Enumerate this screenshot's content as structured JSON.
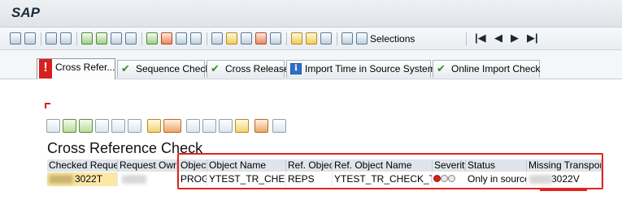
{
  "window": {
    "title": "SAP"
  },
  "toolbar": {
    "selections_label": "Selections"
  },
  "tabs": [
    {
      "label": "Cross Refer...",
      "icon": "error-icon"
    },
    {
      "label": "Sequence Check",
      "icon": "check-icon"
    },
    {
      "label": "Cross Release",
      "icon": "check-icon"
    },
    {
      "label": "Import Time in Source System",
      "icon": "info-icon"
    },
    {
      "label": "Online Import Check",
      "icon": "check-icon"
    }
  ],
  "report": {
    "title": "Cross Reference Check",
    "columns": [
      "Checked Request",
      "Request Owner",
      "Object",
      "Object Name",
      "Ref. Object",
      "Ref. Object Name",
      "Severity",
      "Status",
      "Missing Transport"
    ],
    "rows": [
      {
        "checked_request": "3022T",
        "request_owner": "",
        "object": "PROG",
        "object_name": "YTEST_TR_CHECK",
        "ref_object": "REPS",
        "ref_object_name": "YTEST_TR_CHECK_TOP",
        "severity": "red",
        "status": "Only in source",
        "missing_transport": "3022V"
      }
    ]
  },
  "colors": {
    "highlight": "#e1231f",
    "selected_cell": "#fbe8a6",
    "severity_red": "#d71f1f"
  }
}
